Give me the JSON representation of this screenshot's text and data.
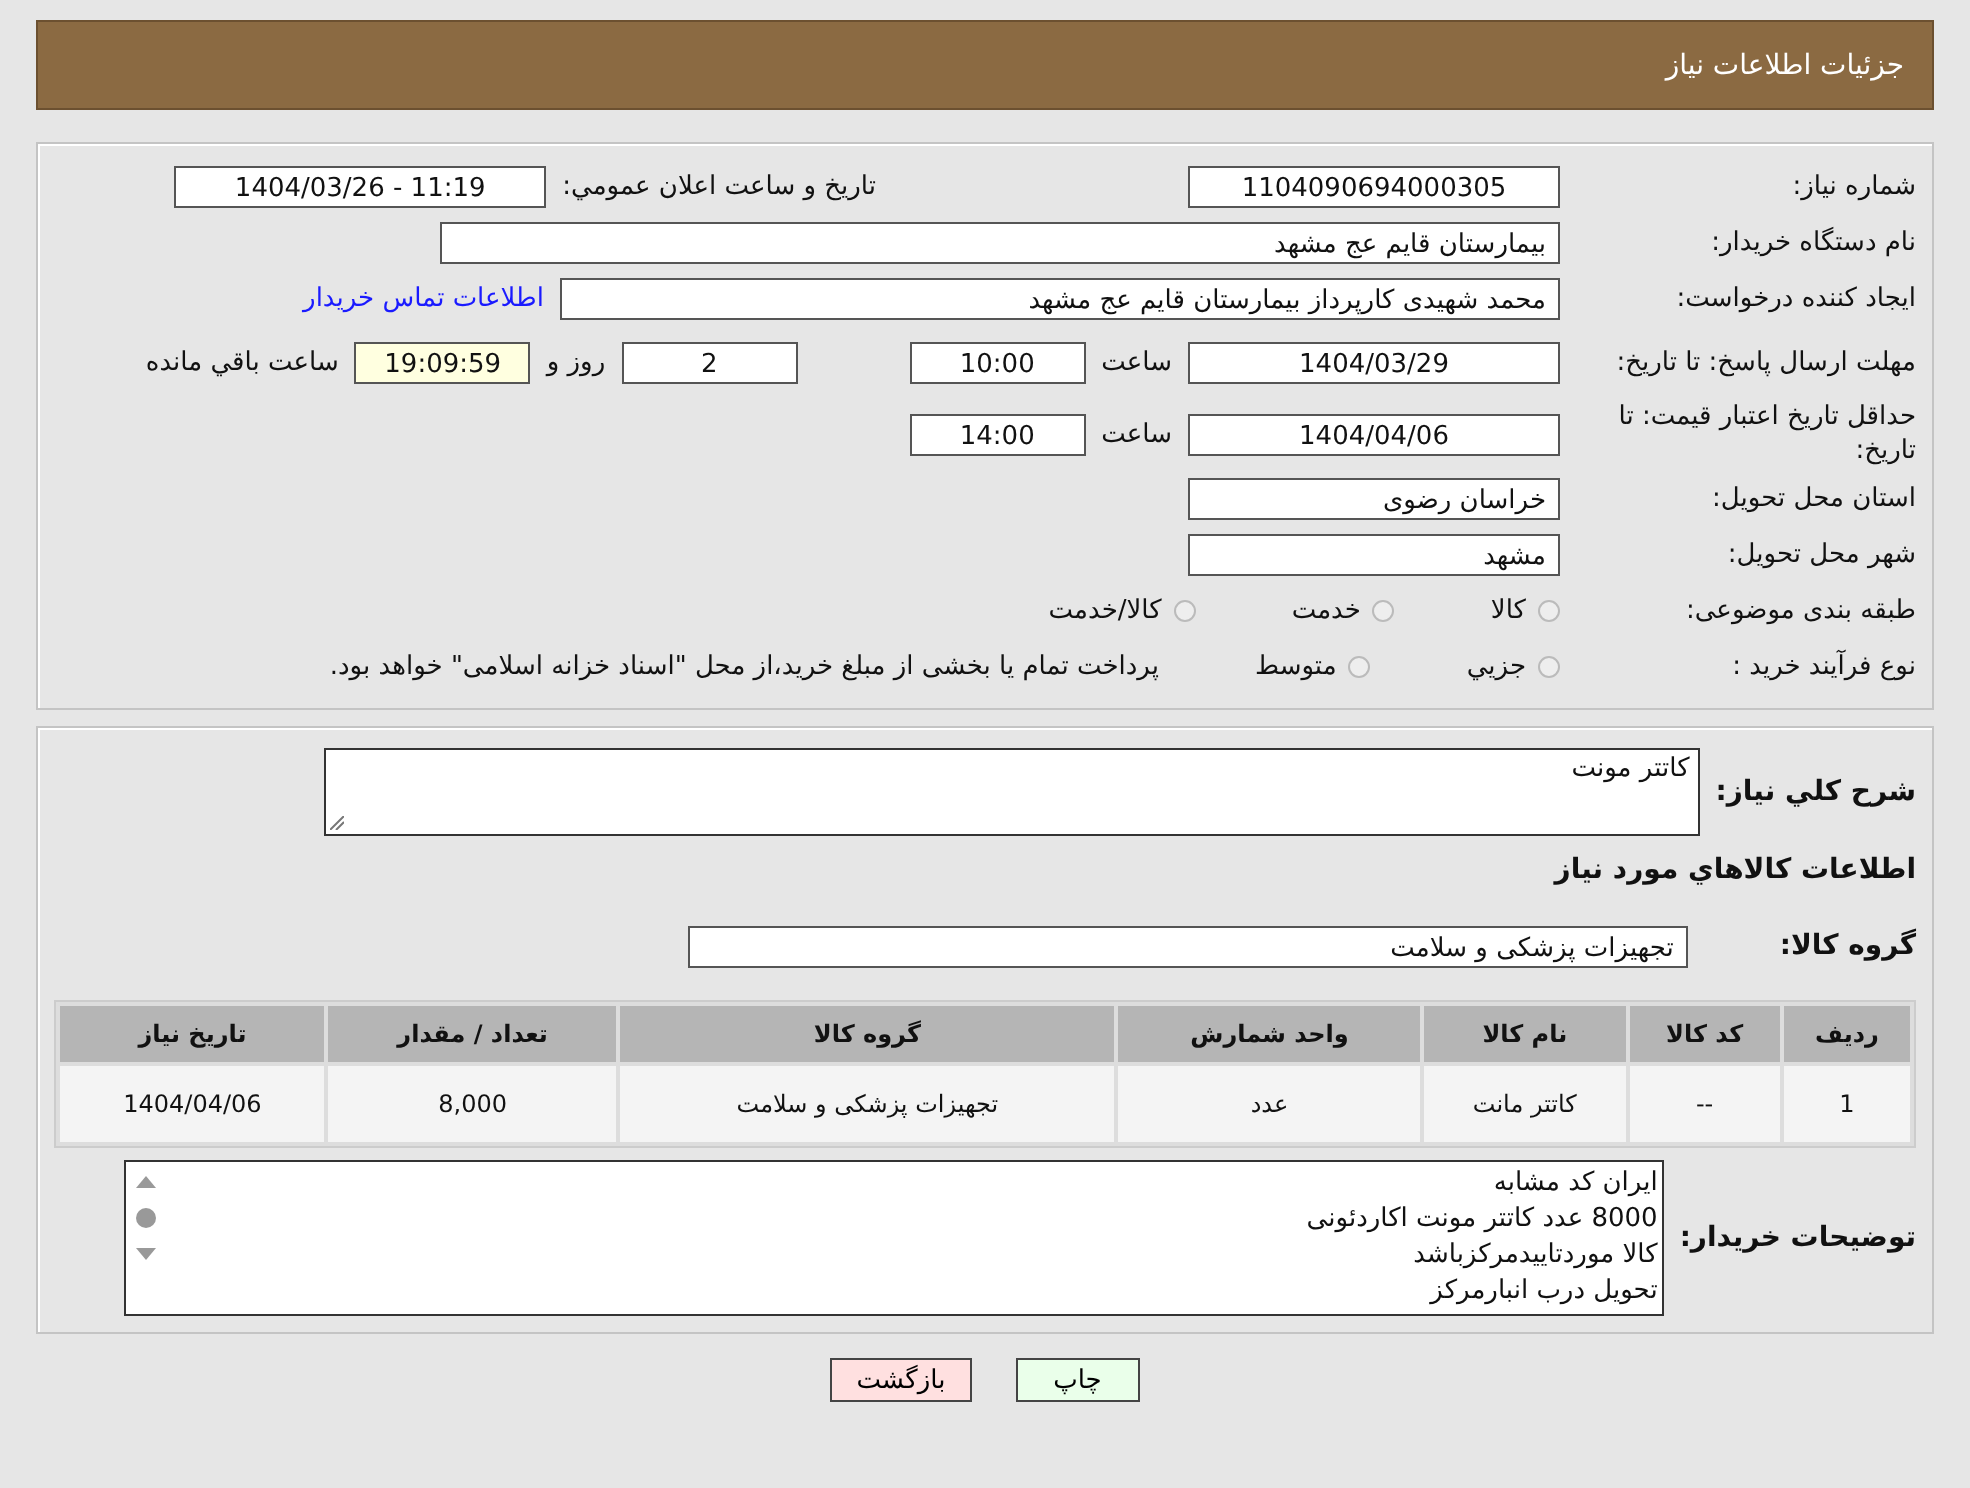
{
  "header": {
    "title": "جزئیات اطلاعات نیاز"
  },
  "details": {
    "need_number": {
      "label": "شماره نیاز:",
      "value": "1104090694000305"
    },
    "announce": {
      "label": "تاریخ و ساعت اعلان عمومي:",
      "value": "1404/03/26 - 11:19"
    },
    "buyer": {
      "label": "نام دستگاه خریدار:",
      "value": "بیمارستان قایم  عج  مشهد"
    },
    "creator": {
      "label": "ایجاد کننده درخواست:",
      "value": "محمد شهیدی کارپرداز بیمارستان قایم  عج  مشهد",
      "link": "اطلاعات تماس خریدار"
    },
    "deadline": {
      "label": "مهلت ارسال پاسخ: تا تاریخ:",
      "date": "1404/03/29",
      "time_label": "ساعت",
      "time": "10:00",
      "days": "2",
      "days_label": "روز و",
      "remaining": "19:09:59",
      "remaining_label": "ساعت باقي مانده"
    },
    "validity": {
      "label": "حداقل تاریخ اعتبار قیمت: تا تاریخ:",
      "date": "1404/04/06",
      "time_label": "ساعت",
      "time": "14:00"
    },
    "province": {
      "label": "استان محل تحویل:",
      "value": "خراسان رضوی"
    },
    "city": {
      "label": "شهر محل تحویل:",
      "value": "مشهد"
    },
    "category": {
      "label": "طبقه بندی موضوعی:",
      "options": [
        {
          "label": "کالا",
          "selected": false
        },
        {
          "label": "خدمت",
          "selected": false
        },
        {
          "label": "کالا/خدمت",
          "selected": false
        }
      ]
    },
    "purchase_type": {
      "label": "نوع فرآیند خرید :",
      "options": [
        {
          "label": "جزيي",
          "selected": false
        },
        {
          "label": "متوسط",
          "selected": false
        }
      ],
      "note": "پرداخت تمام یا بخشی از مبلغ خرید،از محل \"اسناد خزانه اسلامی\" خواهد بود."
    }
  },
  "items_section": {
    "summary": {
      "label": "شرح كلي نياز:",
      "value": "کاتتر مونت"
    },
    "title": "اطلاعات كالاهاي مورد نياز",
    "group": {
      "label": "گروه کالا:",
      "value": "تجهیزات پزشکی و سلامت"
    },
    "table": {
      "columns": [
        "ردیف",
        "کد کالا",
        "نام کالا",
        "واحد شمارش",
        "گروه کالا",
        "تعداد / مقدار",
        "تاریخ نیاز"
      ],
      "rows": [
        [
          "1",
          "--",
          "کاتتر مانت",
          "عدد",
          "تجهیزات پزشکی و سلامت",
          "8,000",
          "1404/04/06"
        ]
      ]
    },
    "notes": {
      "label": "توضیحات خریدار:",
      "lines": [
        "ایران کد مشابه",
        "8000 عدد  کاتتر مونت  اکاردئونی",
        "کالا موردتاییدمرکزباشد",
        "تحویل درب انبارمرکز"
      ]
    }
  },
  "buttons": [
    {
      "label": "چاپ",
      "kind": "print"
    },
    {
      "label": "بازگشت",
      "kind": "back"
    }
  ]
}
